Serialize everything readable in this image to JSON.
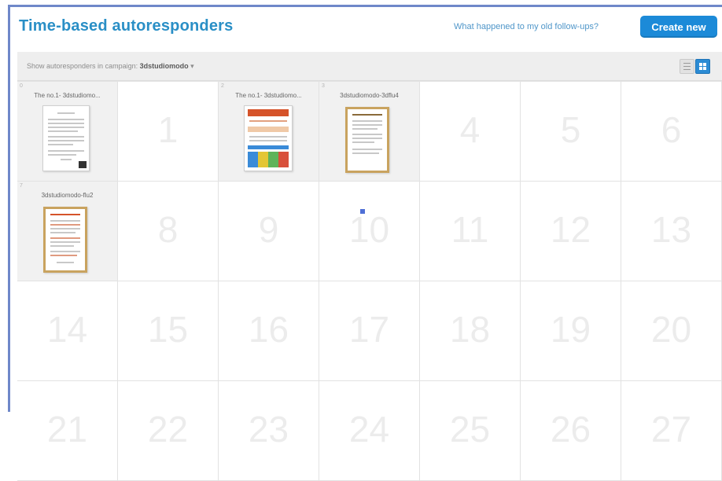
{
  "header": {
    "title": "Time-based autoresponders",
    "help_link": "What happened to my old follow-ups?",
    "create_button": "Create new"
  },
  "toolbar": {
    "filter_label": "Show autoresponders in campaign:",
    "filter_value": "3dstudiomodo",
    "list_view_icon": "list-view-icon",
    "grid_view_icon": "grid-view-icon",
    "accent": "#2b8bd4"
  },
  "calendar": {
    "days": [
      {
        "day": "0",
        "message": "The no.1- 3dstudiomo..."
      },
      {
        "day": "1"
      },
      {
        "day": "2",
        "message": "The no.1- 3dstudiomo..."
      },
      {
        "day": "3",
        "message": "3dstudiomodo-3dflu4"
      },
      {
        "day": "4"
      },
      {
        "day": "5"
      },
      {
        "day": "6"
      },
      {
        "day": "7",
        "message": "3dstudiomodo-flu2"
      },
      {
        "day": "8"
      },
      {
        "day": "9"
      },
      {
        "day": "10"
      },
      {
        "day": "11"
      },
      {
        "day": "12"
      },
      {
        "day": "13"
      },
      {
        "day": "14"
      },
      {
        "day": "15"
      },
      {
        "day": "16"
      },
      {
        "day": "17"
      },
      {
        "day": "18"
      },
      {
        "day": "19"
      },
      {
        "day": "20"
      },
      {
        "day": "21"
      },
      {
        "day": "22"
      },
      {
        "day": "23"
      },
      {
        "day": "24"
      },
      {
        "day": "25"
      },
      {
        "day": "26"
      },
      {
        "day": "27"
      }
    ]
  }
}
